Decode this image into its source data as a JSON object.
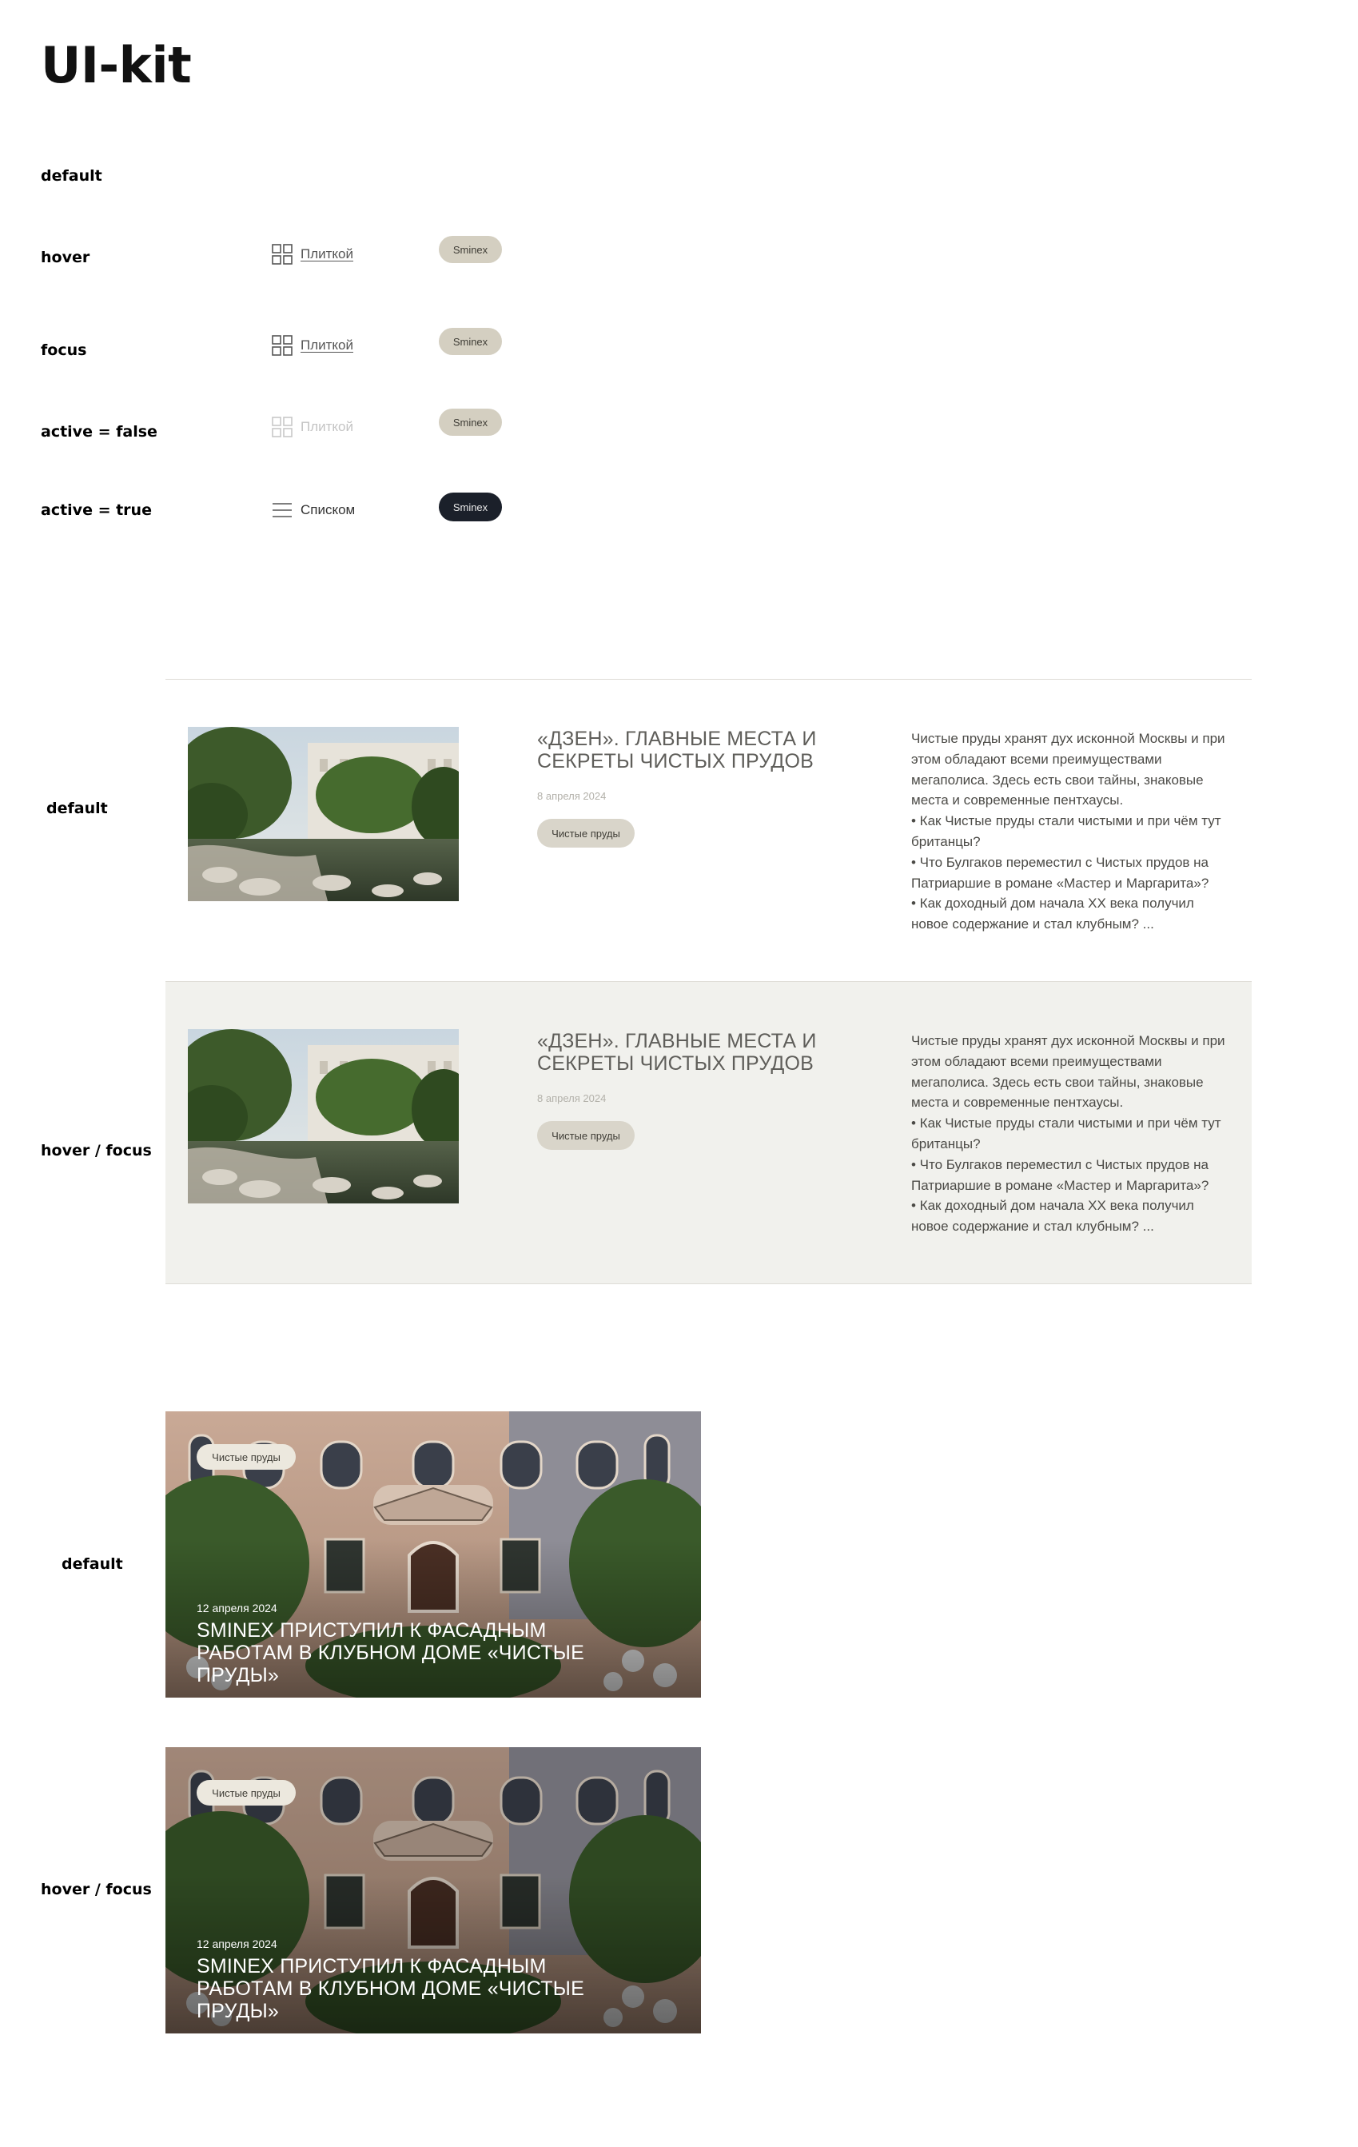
{
  "page": {
    "title": "UI-kit"
  },
  "states": {
    "default": "default",
    "hover": "hover",
    "focus": "focus",
    "active_false": "active = false",
    "active_true": "active = true",
    "hover_focus": "hover / focus"
  },
  "view_toggle": {
    "tile_label": "Плиткой",
    "list_label": "Списком"
  },
  "chip": {
    "label": "Sminex"
  },
  "article": {
    "title": "«ДЗЕН». ГЛАВНЫЕ МЕСТА И СЕКРЕТЫ ЧИСТЫХ ПРУДОВ",
    "date": "8 апреля 2024",
    "tag": "Чистые пруды",
    "excerpt": [
      "Чистые пруды хранят дух исконной Москвы и при этом обладают всеми преимуществами мегаполиса. Здесь есть свои тайны, знаковые места и современные пентхаусы.",
      "• Как Чистые пруды стали чистыми и при чём тут британцы?",
      "• Что Булгаков переместил с Чистых прудов на Патриаршие в романе «Мастер и Маргарита»?",
      "• Как доходный дом начала XX века получил новое содержание и стал клубным? ..."
    ]
  },
  "news_card": {
    "tag": "Чистые пруды",
    "date": "12 апреля 2024",
    "title": "SMINEX ПРИСТУПИЛ К ФАСАДНЫМ РАБОТАМ В КЛУБНОМ ДОМЕ «ЧИСТЫЕ ПРУДЫ»"
  },
  "icons": {
    "tile": "grid-icon",
    "list": "list-icon"
  },
  "colors": {
    "chip_light": "#d4cfc1",
    "chip_dark": "#1b202a",
    "row_hover_bg": "#f1f1ed",
    "tag_bg": "#d9d5ca"
  }
}
